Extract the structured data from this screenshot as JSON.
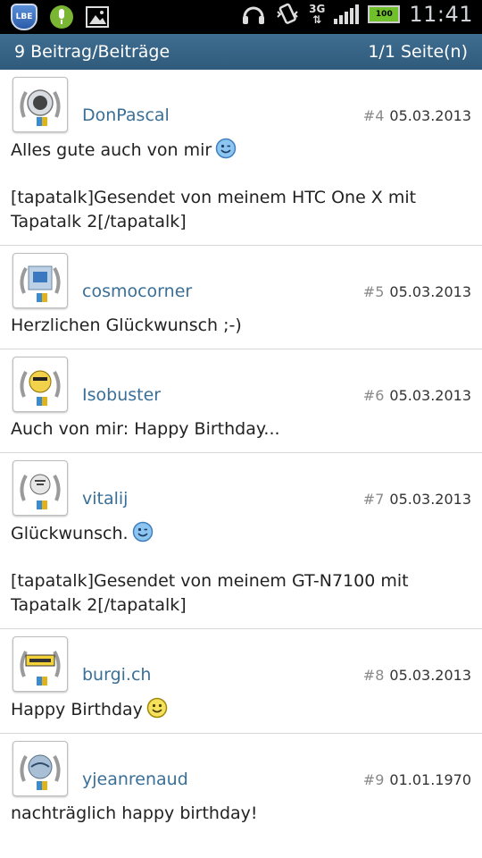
{
  "status_bar": {
    "lbe_label": "LBE",
    "network": "3G",
    "battery": "100",
    "time": "11:41"
  },
  "header": {
    "left": "9 Beitrag/Beiträge",
    "right": "1/1 Seite(n)"
  },
  "posts": [
    {
      "user": "DonPascal",
      "num": "#4",
      "date": "05.03.2013",
      "line1": "Alles gute auch von mir",
      "line2": "[tapatalk]Gesendet von meinem HTC One X mit Tapatalk 2[/tapatalk]"
    },
    {
      "user": "cosmocorner",
      "num": "#5",
      "date": "05.03.2013",
      "line1": "Herzlichen Glückwunsch ;-)",
      "line2": ""
    },
    {
      "user": "Isobuster",
      "num": "#6",
      "date": "05.03.2013",
      "line1": "Auch von mir: Happy Birthday...",
      "line2": ""
    },
    {
      "user": "vitalij",
      "num": "#7",
      "date": "05.03.2013",
      "line1": "Glückwunsch.",
      "line2": "[tapatalk]Gesendet von meinem GT-N7100 mit Tapatalk 2[/tapatalk]"
    },
    {
      "user": "burgi.ch",
      "num": "#8",
      "date": "05.03.2013",
      "line1": "Happy Birthday",
      "line2": ""
    },
    {
      "user": "yjeanrenaud",
      "num": "#9",
      "date": "01.01.1970",
      "line1": "nachträglich happy birthday!",
      "line2": ""
    }
  ]
}
